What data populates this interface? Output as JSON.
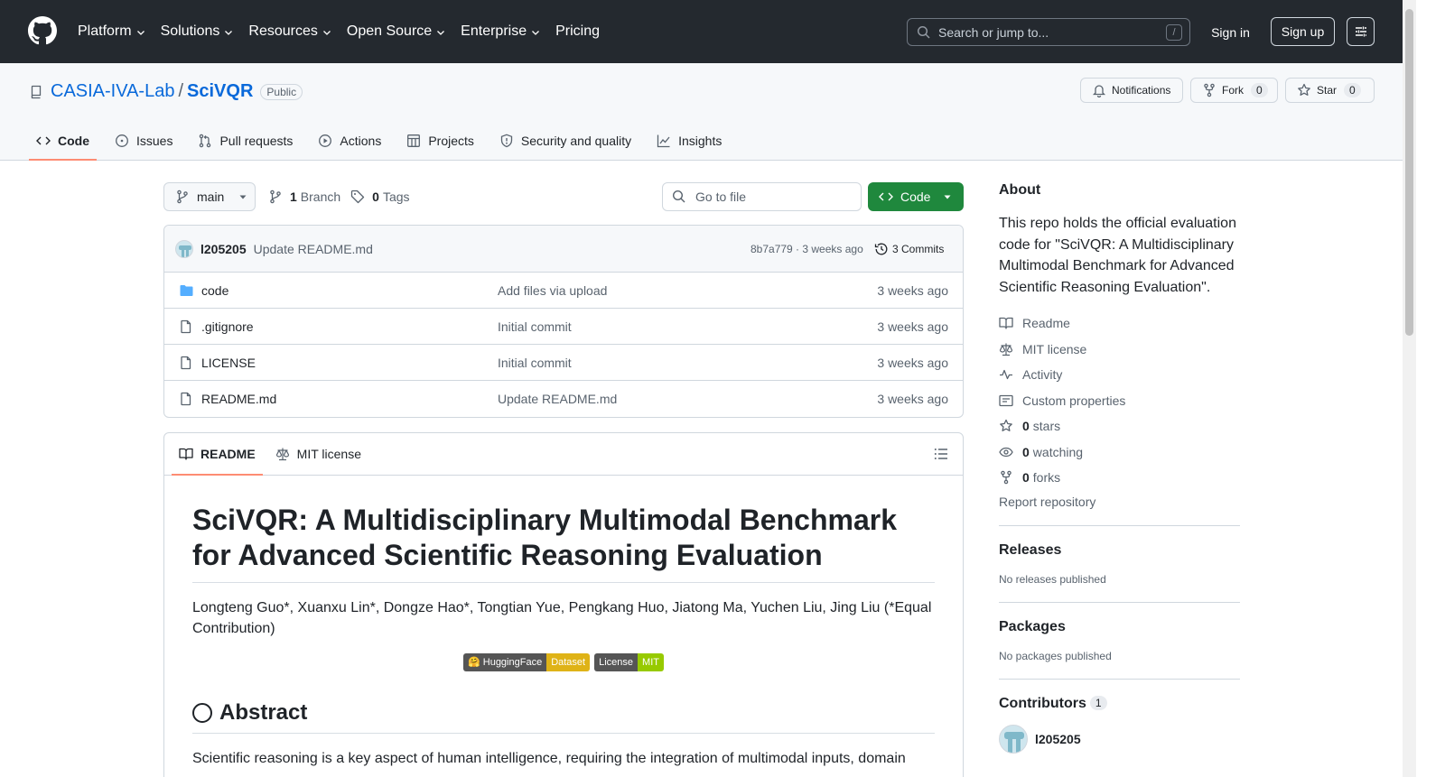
{
  "header": {
    "nav": [
      "Platform",
      "Solutions",
      "Resources",
      "Open Source",
      "Enterprise",
      "Pricing"
    ],
    "search_placeholder": "Search or jump to...",
    "search_shortcut": "/",
    "signin": "Sign in",
    "signup": "Sign up"
  },
  "repo": {
    "owner": "CASIA-IVA-Lab",
    "separator": "/",
    "name": "SciVQR",
    "visibility": "Public",
    "notifications": "Notifications",
    "fork_label": "Fork",
    "fork_count": "0",
    "star_label": "Star",
    "star_count": "0"
  },
  "tabs": [
    "Code",
    "Issues",
    "Pull requests",
    "Actions",
    "Projects",
    "Security and quality",
    "Insights"
  ],
  "toolbar": {
    "branch": "main",
    "branch_count": "1",
    "branch_label": "Branch",
    "tag_count": "0",
    "tag_label": "Tags",
    "goto_placeholder": "Go to file",
    "code_button": "Code"
  },
  "commit": {
    "author": "l205205",
    "message": "Update README.md",
    "hash_time": "8b7a779 · 3 weeks ago",
    "commits": "3 Commits"
  },
  "files": [
    {
      "name": "code",
      "type": "folder",
      "message": "Add files via upload",
      "time": "3 weeks ago"
    },
    {
      "name": ".gitignore",
      "type": "file",
      "message": "Initial commit",
      "time": "3 weeks ago"
    },
    {
      "name": "LICENSE",
      "type": "file",
      "message": "Initial commit",
      "time": "3 weeks ago"
    },
    {
      "name": "README.md",
      "type": "file",
      "message": "Update README.md",
      "time": "3 weeks ago"
    }
  ],
  "readme": {
    "tab_readme": "README",
    "tab_license": "MIT license",
    "title": "SciVQR: A Multidisciplinary Multimodal Benchmark for Advanced Scientific Reasoning Evaluation",
    "authors": "Longteng Guo*, Xuanxu Lin*, Dongze Hao*, Tongtian Yue, Pengkang Huo, Jiatong Ma, Yuchen Liu, Jing Liu (*Equal Contribution)",
    "badge1_left": "🤗 HuggingFace",
    "badge1_right": "Dataset",
    "badge1_color": "#dfb317",
    "badge2_left": "License",
    "badge2_right": "MIT",
    "badge2_color": "#97ca00",
    "abstract_heading": "Abstract",
    "abstract_text": "Scientific reasoning is a key aspect of human intelligence, requiring the integration of multimodal inputs, domain"
  },
  "sidebar": {
    "about_title": "About",
    "about_desc": "This repo holds the official evaluation code for \"SciVQR: A Multidisciplinary Multimodal Benchmark for Advanced Scientific Reasoning Evaluation\".",
    "readme": "Readme",
    "license": "MIT license",
    "activity": "Activity",
    "custom_props": "Custom properties",
    "stars_count": "0",
    "stars_label": "stars",
    "watching_count": "0",
    "watching_label": "watching",
    "forks_count": "0",
    "forks_label": "forks",
    "report": "Report repository",
    "releases_title": "Releases",
    "releases_none": "No releases published",
    "packages_title": "Packages",
    "packages_none": "No packages published",
    "contributors_title": "Contributors",
    "contributors_count": "1",
    "contributor": "l205205"
  },
  "colors": {
    "header_bg": "#24292f",
    "link": "#0969da",
    "primary_button": "#1f883d",
    "active_tab_underline": "#fd8c73",
    "folder": "#54aeff"
  }
}
